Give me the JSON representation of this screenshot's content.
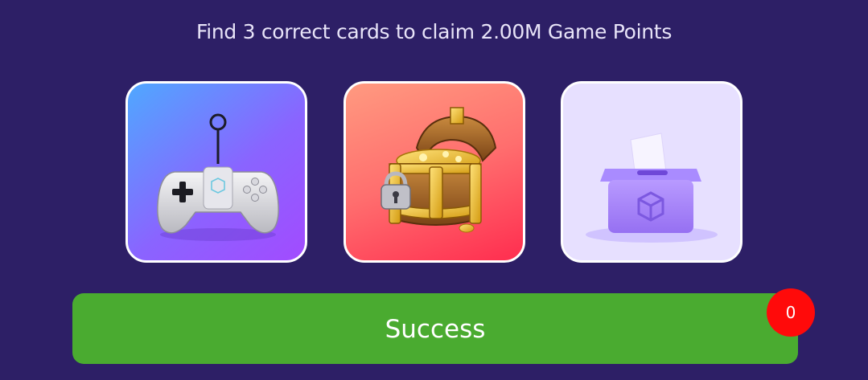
{
  "header": {
    "title": "Find 3 correct cards to claim 2.00M Game Points"
  },
  "cards": [
    {
      "icon": "gamepad-icon"
    },
    {
      "icon": "treasure-chest-icon"
    },
    {
      "icon": "ballot-box-icon"
    }
  ],
  "action": {
    "button_label": "Success",
    "badge_count": "0"
  },
  "colors": {
    "background": "#2d1f66",
    "button": "#4aab30",
    "badge": "#ff0a0a"
  }
}
